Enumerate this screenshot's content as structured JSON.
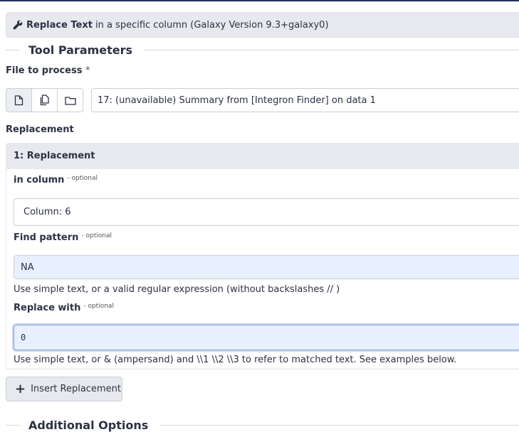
{
  "tool_header": {
    "name": "Replace Text",
    "description": "in a specific column (Galaxy Version 9.3+galaxy0)"
  },
  "sections": {
    "tool_parameters": "Tool Parameters",
    "additional_options": "Additional Options"
  },
  "file_to_process": {
    "label": "File to process",
    "required_mark": "*",
    "value": "17: (unavailable) Summary from [Integron Finder] on data 1",
    "buttons": [
      "single-dataset",
      "multiple-datasets",
      "dataset-collection"
    ]
  },
  "replacement": {
    "label": "Replacement",
    "item_title": "1: Replacement",
    "optional_tag": "- optional",
    "in_column": {
      "label": "in column",
      "value": "Column: 6"
    },
    "find_pattern": {
      "label": "Find pattern",
      "value": "NA",
      "help": "Use simple text, or a valid regular expression (without backslashes // )"
    },
    "replace_with": {
      "label": "Replace with",
      "value": "0",
      "help": "Use simple text, or & (ampersand) and \\\\1 \\\\2 \\\\3 to refer to matched text. See examples below."
    },
    "insert_button": "Insert Replacement"
  },
  "colors": {
    "header_bg": "#e7e9ee",
    "autofill_bg": "#e8f0fe",
    "text": "#2c3143"
  }
}
